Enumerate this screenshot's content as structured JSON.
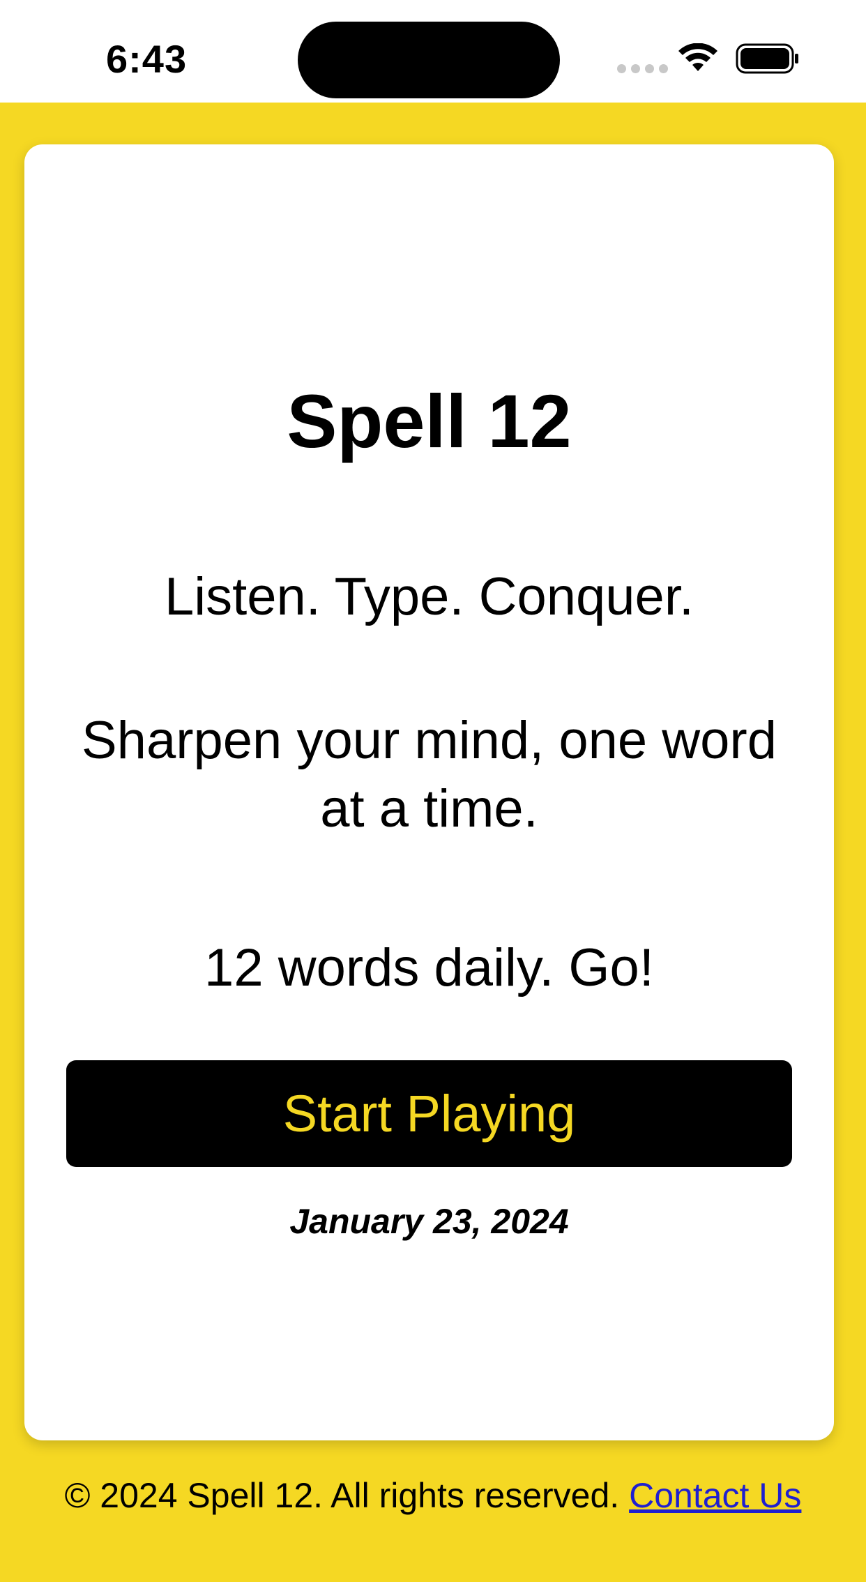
{
  "status_bar": {
    "time": "6:43"
  },
  "app": {
    "title": "Spell 12",
    "tagline": "Listen. Type. Conquer.",
    "subline": "Sharpen your mind, one word at a time.",
    "daily": "12 words daily. Go!",
    "start_button_label": "Start Playing",
    "date": "January 23, 2024"
  },
  "footer": {
    "copyright": "© 2024 Spell 12. All rights reserved.",
    "contact_label": "Contact Us"
  },
  "colors": {
    "accent_yellow": "#f5d823",
    "button_bg": "#000000",
    "link_blue": "#1f1fd0"
  }
}
